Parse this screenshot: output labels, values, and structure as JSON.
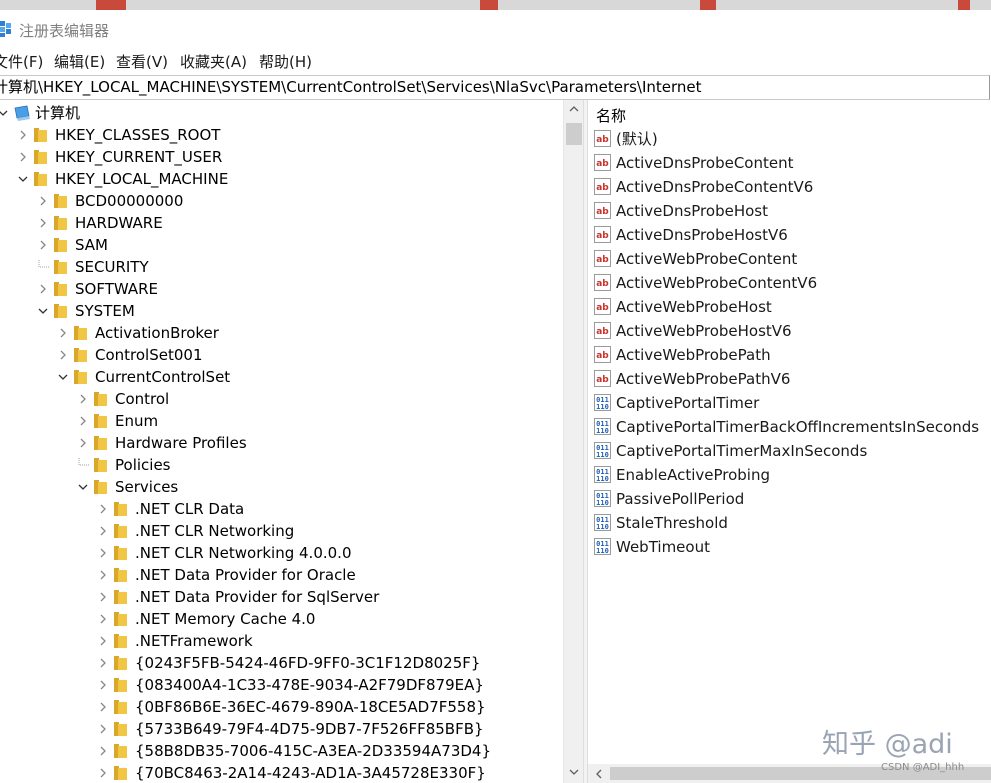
{
  "window": {
    "title": "注册表编辑器"
  },
  "menu": [
    "文件(F)",
    "编辑(E)",
    "查看(V)",
    "收藏夹(A)",
    "帮助(H)"
  ],
  "address": "计算机\\HKEY_LOCAL_MACHINE\\SYSTEM\\CurrentControlSet\\Services\\NlaSvc\\Parameters\\Internet",
  "tree": {
    "root_label": "计算机",
    "nodes": [
      {
        "label": "HKEY_CLASSES_ROOT",
        "depth": 1,
        "state": "collapsed"
      },
      {
        "label": "HKEY_CURRENT_USER",
        "depth": 1,
        "state": "collapsed"
      },
      {
        "label": "HKEY_LOCAL_MACHINE",
        "depth": 1,
        "state": "expanded"
      },
      {
        "label": "BCD00000000",
        "depth": 2,
        "state": "collapsed"
      },
      {
        "label": "HARDWARE",
        "depth": 2,
        "state": "collapsed"
      },
      {
        "label": "SAM",
        "depth": 2,
        "state": "collapsed"
      },
      {
        "label": "SECURITY",
        "depth": 2,
        "state": "leaf"
      },
      {
        "label": "SOFTWARE",
        "depth": 2,
        "state": "collapsed"
      },
      {
        "label": "SYSTEM",
        "depth": 2,
        "state": "expanded"
      },
      {
        "label": "ActivationBroker",
        "depth": 3,
        "state": "collapsed"
      },
      {
        "label": "ControlSet001",
        "depth": 3,
        "state": "collapsed"
      },
      {
        "label": "CurrentControlSet",
        "depth": 3,
        "state": "expanded"
      },
      {
        "label": "Control",
        "depth": 4,
        "state": "collapsed"
      },
      {
        "label": "Enum",
        "depth": 4,
        "state": "collapsed"
      },
      {
        "label": "Hardware Profiles",
        "depth": 4,
        "state": "collapsed"
      },
      {
        "label": "Policies",
        "depth": 4,
        "state": "leaf"
      },
      {
        "label": "Services",
        "depth": 4,
        "state": "expanded"
      },
      {
        "label": ".NET CLR Data",
        "depth": 5,
        "state": "collapsed"
      },
      {
        "label": ".NET CLR Networking",
        "depth": 5,
        "state": "collapsed"
      },
      {
        "label": ".NET CLR Networking 4.0.0.0",
        "depth": 5,
        "state": "collapsed"
      },
      {
        "label": ".NET Data Provider for Oracle",
        "depth": 5,
        "state": "collapsed"
      },
      {
        "label": ".NET Data Provider for SqlServer",
        "depth": 5,
        "state": "collapsed"
      },
      {
        "label": ".NET Memory Cache 4.0",
        "depth": 5,
        "state": "collapsed"
      },
      {
        "label": ".NETFramework",
        "depth": 5,
        "state": "collapsed"
      },
      {
        "label": "{0243F5FB-5424-46FD-9FF0-3C1F12D8025F}",
        "depth": 5,
        "state": "collapsed"
      },
      {
        "label": "{083400A4-1C33-478E-9034-A2F79DF879EA}",
        "depth": 5,
        "state": "collapsed"
      },
      {
        "label": "{0BF86B6E-36EC-4679-890A-18CE5AD7F558}",
        "depth": 5,
        "state": "collapsed"
      },
      {
        "label": "{5733B649-79F4-4D75-9DB7-7F526FF85BFB}",
        "depth": 5,
        "state": "collapsed"
      },
      {
        "label": "{58B8DB35-7006-415C-A3EA-2D33594A73D4}",
        "depth": 5,
        "state": "collapsed"
      },
      {
        "label": "{70BC8463-2A14-4243-AD1A-3A45728E330F}",
        "depth": 5,
        "state": "collapsed"
      }
    ]
  },
  "values": {
    "header": "名称",
    "items": [
      {
        "name": "(默认)",
        "type": "string"
      },
      {
        "name": "ActiveDnsProbeContent",
        "type": "string"
      },
      {
        "name": "ActiveDnsProbeContentV6",
        "type": "string"
      },
      {
        "name": "ActiveDnsProbeHost",
        "type": "string"
      },
      {
        "name": "ActiveDnsProbeHostV6",
        "type": "string"
      },
      {
        "name": "ActiveWebProbeContent",
        "type": "string"
      },
      {
        "name": "ActiveWebProbeContentV6",
        "type": "string"
      },
      {
        "name": "ActiveWebProbeHost",
        "type": "string"
      },
      {
        "name": "ActiveWebProbeHostV6",
        "type": "string"
      },
      {
        "name": "ActiveWebProbePath",
        "type": "string"
      },
      {
        "name": "ActiveWebProbePathV6",
        "type": "string"
      },
      {
        "name": "CaptivePortalTimer",
        "type": "dword"
      },
      {
        "name": "CaptivePortalTimerBackOffIncrementsInSeconds",
        "type": "dword"
      },
      {
        "name": "CaptivePortalTimerMaxInSeconds",
        "type": "dword"
      },
      {
        "name": "EnableActiveProbing",
        "type": "dword"
      },
      {
        "name": "PassivePollPeriod",
        "type": "dword"
      },
      {
        "name": "StaleThreshold",
        "type": "dword"
      },
      {
        "name": "WebTimeout",
        "type": "dword"
      }
    ]
  },
  "watermark": "知乎 @adi",
  "credit": "CSDN @ADI_hhh",
  "colors": {
    "folder": "#f1c644",
    "folder_dark": "#dba72a",
    "string_icon": "#c8322d",
    "dword_icon": "#1d5fb5"
  }
}
